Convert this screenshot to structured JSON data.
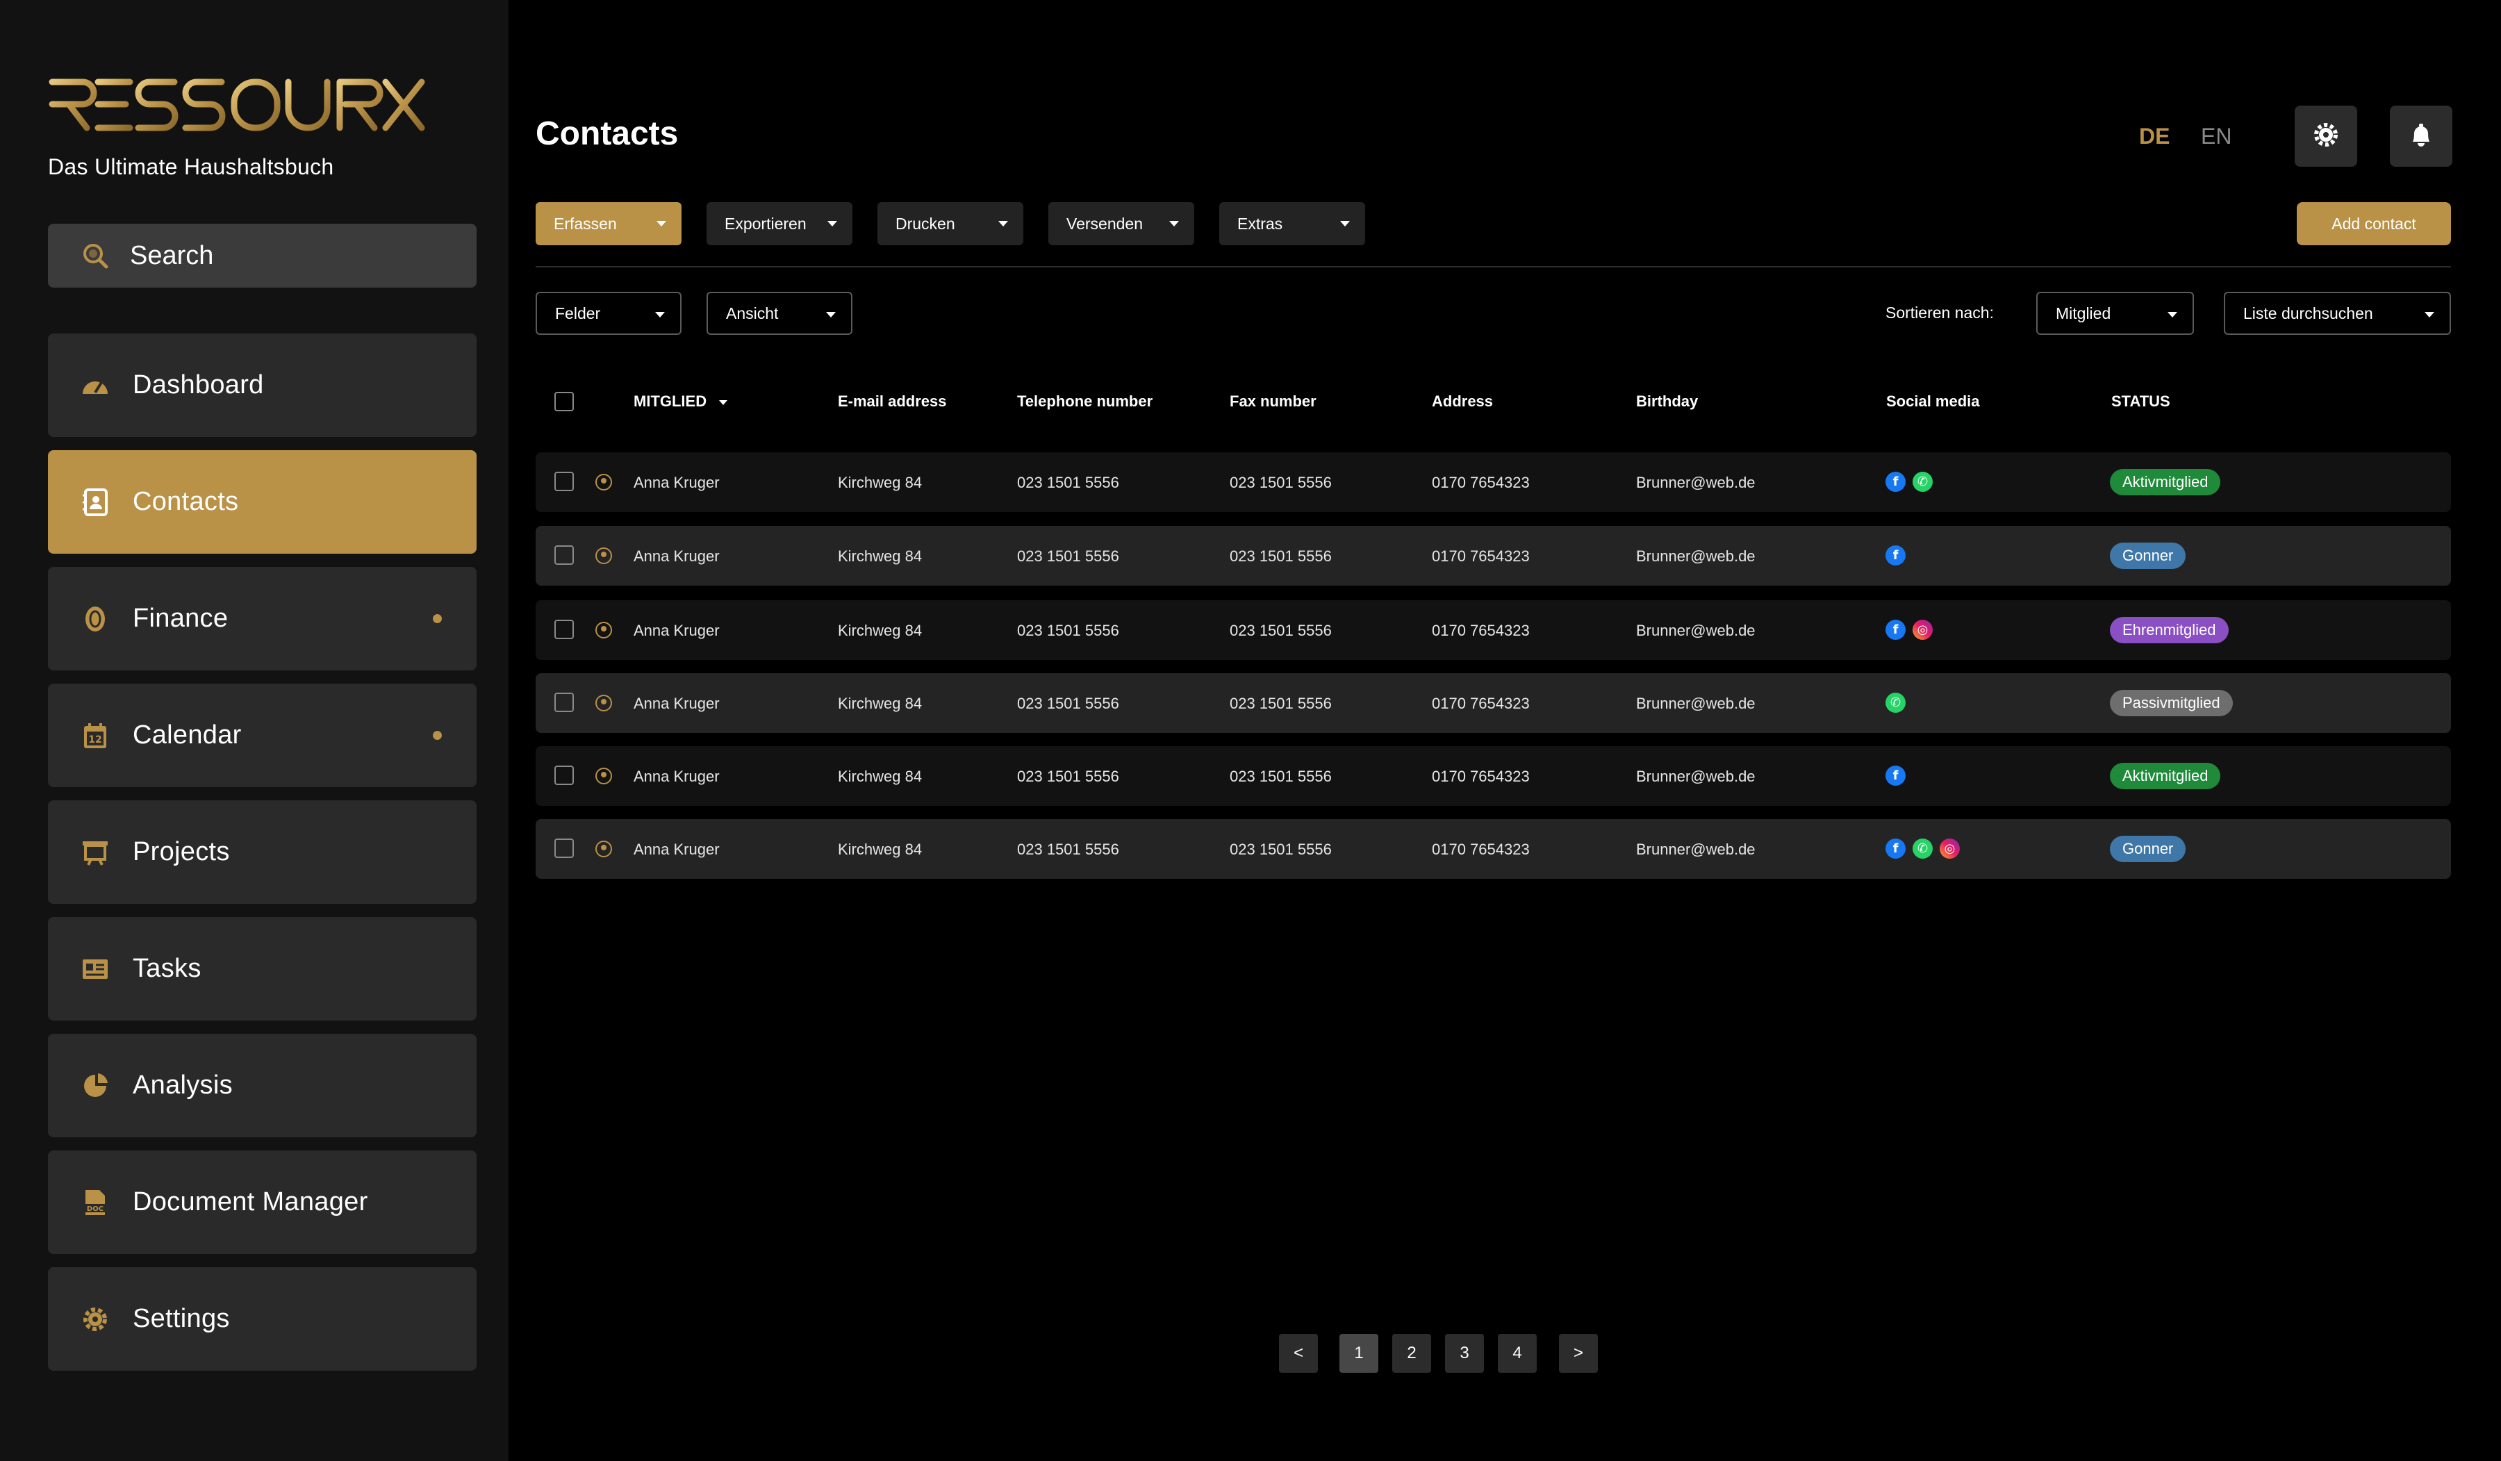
{
  "brand": {
    "logo_text": "RESSOURX",
    "tagline": "Das Ultimate Haushaltsbuch",
    "accent": "#b99147"
  },
  "search": {
    "label": "Search"
  },
  "sidebar": {
    "items": [
      {
        "label": "Dashboard",
        "icon": "dashboard-icon",
        "active": false,
        "dot": false
      },
      {
        "label": "Contacts",
        "icon": "contacts-icon",
        "active": true,
        "dot": false
      },
      {
        "label": "Finance",
        "icon": "finance-icon",
        "active": false,
        "dot": true
      },
      {
        "label": "Calendar",
        "icon": "calendar-icon",
        "active": false,
        "dot": true
      },
      {
        "label": "Projects",
        "icon": "projects-icon",
        "active": false,
        "dot": false
      },
      {
        "label": "Tasks",
        "icon": "tasks-icon",
        "active": false,
        "dot": false
      },
      {
        "label": "Analysis",
        "icon": "analysis-icon",
        "active": false,
        "dot": false
      },
      {
        "label": "Document Manager",
        "icon": "document-icon",
        "active": false,
        "dot": false
      },
      {
        "label": "Settings",
        "icon": "settings-icon",
        "active": false,
        "dot": false
      }
    ]
  },
  "header": {
    "title": "Contacts",
    "lang_de": "DE",
    "lang_en": "EN",
    "active_lang": "DE"
  },
  "toolbar": {
    "dropdowns": [
      "Erfassen",
      "Exportieren",
      "Drucken",
      "Versenden",
      "Extras"
    ],
    "add_contact": "Add contact"
  },
  "filters": {
    "felder": "Felder",
    "ansicht": "Ansicht",
    "sort_label": "Sortieren nach:",
    "sort_value": "Mitglied",
    "search_list": "Liste durchsuchen"
  },
  "table": {
    "columns": [
      "MITGLIED",
      "E-mail address",
      "Telephone number",
      "Fax number",
      "Address",
      "Birthday",
      "Social media",
      "STATUS"
    ],
    "rows": [
      {
        "name": "Anna Kruger",
        "email": "Kirchweg 84",
        "phone": "023 1501 5556",
        "fax": "023 1501 5556",
        "address": "0170 7654323",
        "birthday": "Brunner@web.de",
        "social": [
          "facebook",
          "whatsapp"
        ],
        "status": "Aktivmitglied",
        "status_color": "#1e8a3a"
      },
      {
        "name": "Anna Kruger",
        "email": "Kirchweg 84",
        "phone": "023 1501 5556",
        "fax": "023 1501 5556",
        "address": "0170 7654323",
        "birthday": "Brunner@web.de",
        "social": [
          "facebook"
        ],
        "status": "Gonner",
        "status_color": "#3f78a8"
      },
      {
        "name": "Anna Kruger",
        "email": "Kirchweg 84",
        "phone": "023 1501 5556",
        "fax": "023 1501 5556",
        "address": "0170 7654323",
        "birthday": "Brunner@web.de",
        "social": [
          "facebook",
          "instagram"
        ],
        "status": "Ehrenmitglied",
        "status_color": "#8a4fc2"
      },
      {
        "name": "Anna Kruger",
        "email": "Kirchweg 84",
        "phone": "023 1501 5556",
        "fax": "023 1501 5556",
        "address": "0170 7654323",
        "birthday": "Brunner@web.de",
        "social": [
          "whatsapp"
        ],
        "status": "Passivmitglied",
        "status_color": "#6e6e6e"
      },
      {
        "name": "Anna Kruger",
        "email": "Kirchweg 84",
        "phone": "023 1501 5556",
        "fax": "023 1501 5556",
        "address": "0170 7654323",
        "birthday": "Brunner@web.de",
        "social": [
          "facebook"
        ],
        "status": "Aktivmitglied",
        "status_color": "#1e8a3a"
      },
      {
        "name": "Anna Kruger",
        "email": "Kirchweg 84",
        "phone": "023 1501 5556",
        "fax": "023 1501 5556",
        "address": "0170 7654323",
        "birthday": "Brunner@web.de",
        "social": [
          "facebook",
          "whatsapp",
          "instagram"
        ],
        "status": "Gonner",
        "status_color": "#3f78a8"
      }
    ]
  },
  "pagination": {
    "prev": "<",
    "pages": [
      "1",
      "2",
      "3",
      "4"
    ],
    "current": "1",
    "next": ">"
  }
}
